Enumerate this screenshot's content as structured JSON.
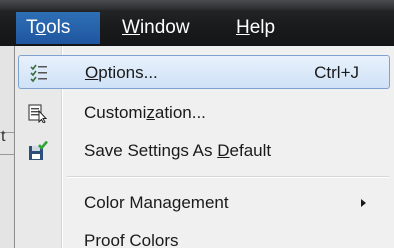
{
  "menubar": {
    "items": [
      {
        "pre": "T",
        "ul": "o",
        "post": "ols",
        "active": true
      },
      {
        "pre": "",
        "ul": "W",
        "post": "indow",
        "active": false
      },
      {
        "pre": "",
        "ul": "H",
        "post": "elp",
        "active": false
      }
    ]
  },
  "menu": {
    "options": {
      "pre": "",
      "ul": "O",
      "post": "ptions...",
      "shortcut": "Ctrl+J",
      "icon": "options-checklist-icon"
    },
    "customization": {
      "pre": "Customi",
      "ul": "z",
      "post": "ation...",
      "icon": "customization-icon"
    },
    "save_settings": {
      "pre": "Save Settings As ",
      "ul": "D",
      "post": "efault",
      "icon": "save-floppy-icon"
    },
    "color_management": {
      "label": "Color Management",
      "icon": "submenu-arrow-icon"
    },
    "proof_colors": {
      "label": "Proof Colors"
    }
  },
  "background": {
    "left_char": "t"
  },
  "colors": {
    "menu_active": "#1f56a0",
    "highlight_border": "#7da2ce",
    "menu_bg": "#f0f0f0"
  }
}
